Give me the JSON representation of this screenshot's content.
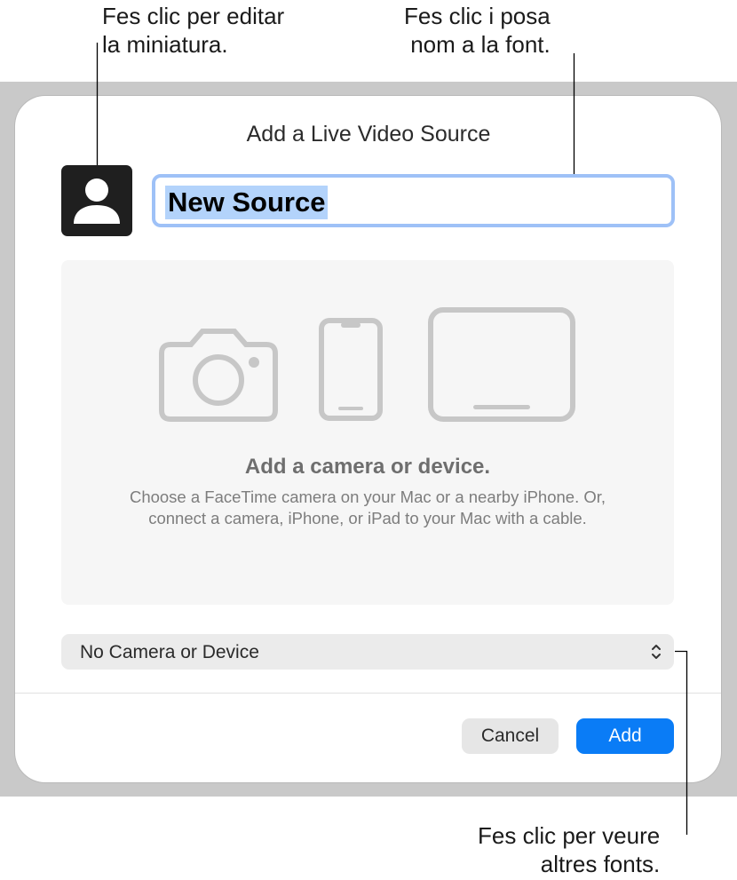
{
  "callouts": {
    "thumbnail": [
      "Fes clic per editar",
      "la miniatura."
    ],
    "name": [
      "Fes clic i posa",
      "nom a la font."
    ],
    "popup": [
      "Fes clic per veure",
      "altres fonts."
    ]
  },
  "dialog": {
    "title": "Add a Live Video Source",
    "name_field_value": "New Source",
    "drop_area": {
      "heading": "Add a camera or device.",
      "description": "Choose a FaceTime camera on your Mac or a nearby iPhone. Or, connect a camera, iPhone, or iPad to your Mac with a cable."
    },
    "source_popup": {
      "selected": "No Camera or Device"
    },
    "buttons": {
      "cancel": "Cancel",
      "add": "Add"
    }
  },
  "colors": {
    "accent": "#0a7cf6",
    "focus_ring": "#9ec1f7",
    "selection": "#b3d3fb",
    "backdrop": "#c9c9c9"
  },
  "icons": {
    "thumbnail": "person-icon",
    "drop_area": [
      "camera-icon",
      "iphone-icon",
      "ipad-icon"
    ],
    "popup": "chevron-up-down-icon"
  }
}
